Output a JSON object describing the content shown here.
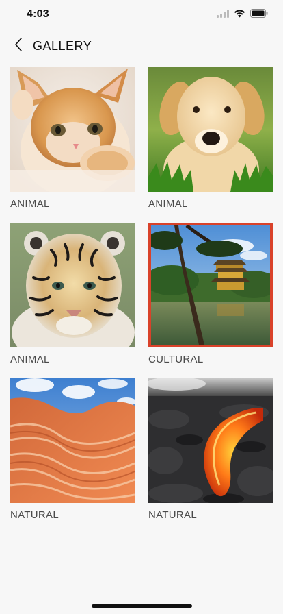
{
  "status": {
    "time": "4:03"
  },
  "header": {
    "title": "GALLERY"
  },
  "gallery": {
    "items": [
      {
        "caption": "ANIMAL",
        "image": "kitten-photo",
        "selected": false
      },
      {
        "caption": "ANIMAL",
        "image": "puppy-photo",
        "selected": false
      },
      {
        "caption": "ANIMAL",
        "image": "tiger-photo",
        "selected": false
      },
      {
        "caption": "CULTURAL",
        "image": "pagoda-temple-photo",
        "selected": true
      },
      {
        "caption": "NATURAL",
        "image": "sandstone-canyon-photo",
        "selected": false
      },
      {
        "caption": "NATURAL",
        "image": "lava-flow-photo",
        "selected": false
      }
    ]
  },
  "colors": {
    "selected_border": "#d9422a",
    "background": "#f7f7f7"
  }
}
